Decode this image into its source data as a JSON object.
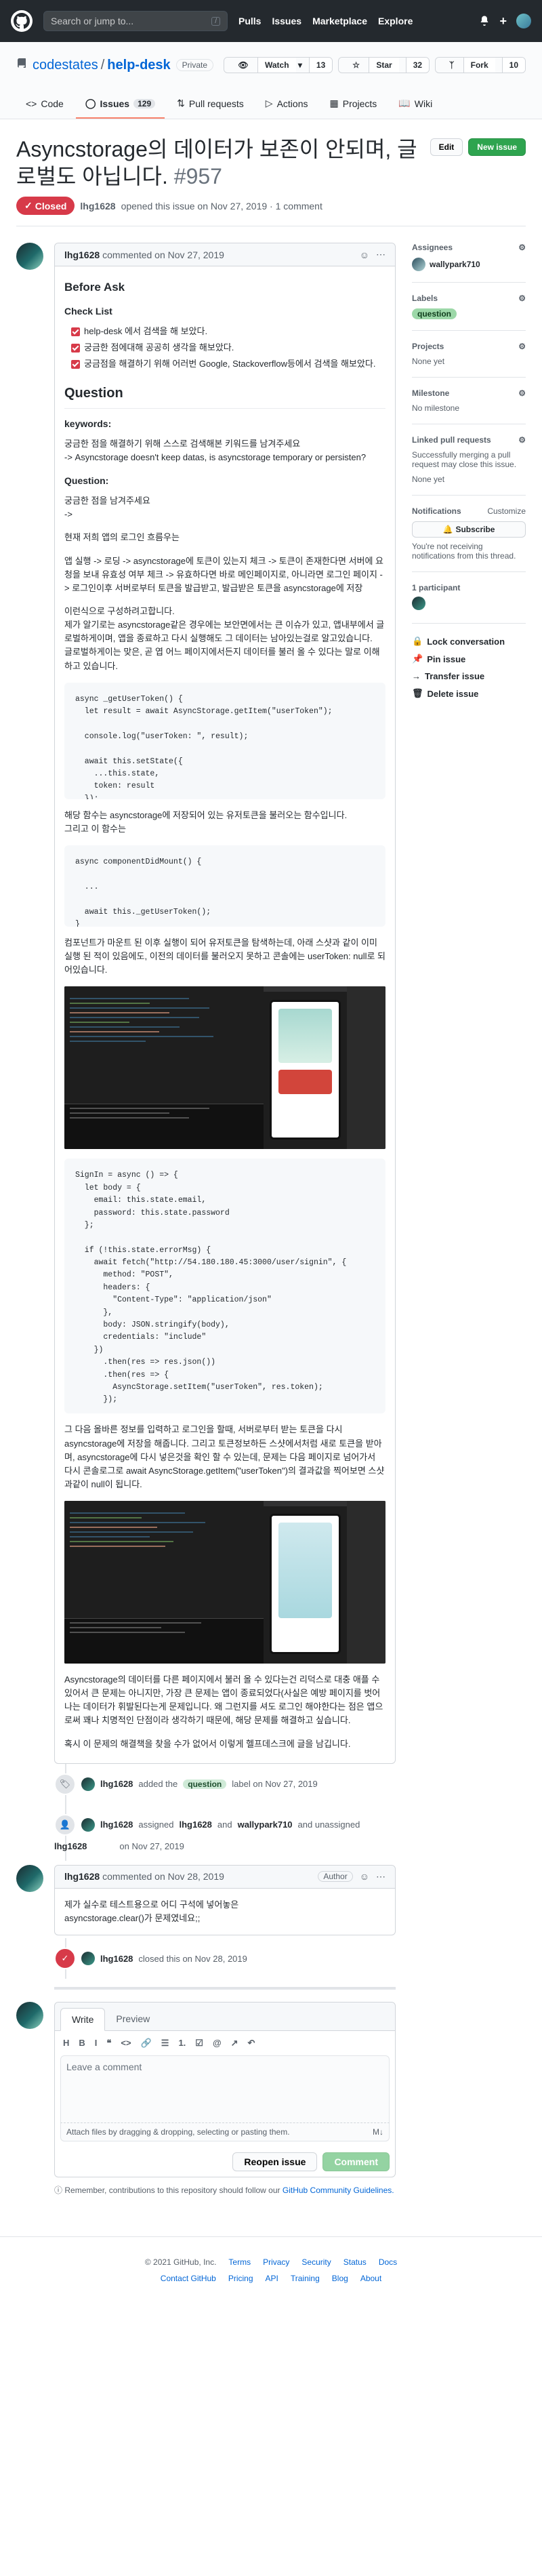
{
  "header": {
    "search_placeholder": "Search or jump to...",
    "search_key": "/",
    "nav": [
      "Pulls",
      "Issues",
      "Marketplace",
      "Explore"
    ],
    "plus": "+"
  },
  "repo": {
    "owner": "codestates",
    "name": "help-desk",
    "visibility": "Private",
    "watch_label": "Watch",
    "watch_count": "13",
    "star_label": "Star",
    "star_count": "32",
    "fork_label": "Fork",
    "fork_count": "10",
    "tabs": [
      {
        "label": "Code"
      },
      {
        "label": "Issues",
        "count": "129"
      },
      {
        "label": "Pull requests"
      },
      {
        "label": "Actions"
      },
      {
        "label": "Projects"
      },
      {
        "label": "Wiki"
      }
    ]
  },
  "issue": {
    "title": "Asyncstorage의 데이터가 보존이 안되며, 글로벌도 아닙니다.",
    "number": "#957",
    "edit_label": "Edit",
    "new_issue_label": "New issue",
    "state": "Closed",
    "author": "lhg1628",
    "opened_text": "opened this issue on Nov 27, 2019 · 1 comment"
  },
  "main_comment": {
    "author": "lhg1628",
    "date_text": "commented on Nov 27, 2019",
    "h_before": "Before Ask",
    "checklist_title": "Check List",
    "checklist": [
      "help-desk 에서 검색을 해 보았다.",
      "궁금한 점에대해 공공히 생각을 해보았다.",
      "궁금점을 해결하기 위해 어러번 Google, Stackoverflow등에서 검색을 해보았다."
    ],
    "h_question": "Question",
    "keywords_title": "keywords:",
    "keywords_text": "궁금한 점을 해결하기 위해 스스로 검색해본 키워드를 남겨주세요\n-> Asyncstorage doesn't keep datas, is asyncstorage temporary or persisten?",
    "question_title": "Question:",
    "question_text": "궁금한 점을 남겨주세요\n->",
    "p1": "현재 저희 앱의 로그인 흐름우는",
    "p2": "앱 실행 -> 로딩 -> asyncstorage에 토큰이 있는지 체크 -> 토큰이 존재한다면 서버에 요청을 보내 유효성 여부 체크 -> 유효하다면 바로 메인페이지로, 아니라면 로그인 페이지 -> 로그인이후 서버로부터 토큰을 발급받고, 발급받은 토큰을 asyncstorage에 저장",
    "p3": "이런식으로 구성하려고합니다.\n제가 알기로는 asyncstorage같은 경우에는 보안면에서는 큰 이슈가 있고, 앱내부에서 글로벌하게이며, 앱을 종료하고 다시 실행해도 그 데이터는 남아있는걸로 알고있습니다.\n글로벌하게이는 맞은, 곧 엽 어느 페이지에서든지 데이터를 불러 올 수 있다는 말로 이해 하고 있습니다.",
    "code1": "async _getUserToken() {\n  let result = await AsyncStorage.getItem(\"userToken\");\n\n  console.log(\"userToken: \", result);\n\n  await this.setState({\n    ...this.state,\n    token: result\n  });\n}",
    "p4": "해당 함수는 asyncstorage에 저장되어 있는 유저토큰을 불러오는 함수입니다.\n그리고 이 함수는",
    "code2": "async componentDidMount() {\n\n  ...\n\n  await this._getUserToken();\n}",
    "p5": "컴포넌트가 마운트 된 이후 실행이 되어 유저토큰을 탐색하는데, 아래 스샷과 같이 이미 실행 된 적이 있음에도, 이전의 데이터를 불러오지 못하고 콘솔에는 userToken: null로 되어있습니다.",
    "code3": "SignIn = async () => {\n  let body = {\n    email: this.state.email,\n    password: this.state.password\n  };\n\n  if (!this.state.errorMsg) {\n    await fetch(\"http://54.180.180.45:3000/user/signin\", {\n      method: \"POST\",\n      headers: {\n        \"Content-Type\": \"application/json\"\n      },\n      body: JSON.stringify(body),\n      credentials: \"include\"\n    })\n      .then(res => res.json())\n      .then(res => {\n        AsyncStorage.setItem(\"userToken\", res.token);\n      });\n\n    await this._getUserToken();\n\n    await this.props.navigation.navigate(\"MainPart\");\n  }\n};",
    "p6": "그 다음 올바른 정보를 입력하고 로그인을 할때, 서버로부터 받는 토큰을 다시 asyncstorage에 저장을 해줍니다. 그리고 토큰정보하든 스샷에서처럼 새로 토큰을 받아며, asyncstorage에 다시 넣은것을 확인 할 수 있는데, 문제는 다음 페이지로 넘어가서 다시 콘솔로그로 await AsyncStorage.getItem(\"userToken\")의 결과값을 찍어보면 스샷과같이 null이 됩니다.",
    "p7": "Asyncstorage의 데이터를 다른 페이지에서 불러 올 수 있다는건 리덕스로 대충 애플 수 있어서 큰 문제는 아니지만, 가장 큰 문제는 앱이 종료되었다(사실은 예방 페이지를 벗어나는 데이터가 휘발된다는게 문제입니다. 왜 그런지를 셔도 로그인 해야한다는 점은 앱으로써 꽤나 치명적인 단점이라 생각하기 때문에, 해당 문제를 해결하고 싶습니다.",
    "p8": "혹시 이 문제의 해결책을 찾을 수가 없어서 이렇게 헬프데스크에 글을 남깁니다."
  },
  "events": {
    "label_actor": "lhg1628",
    "label_text_a": "added the",
    "label_name": "question",
    "label_text_b": "label on Nov 27, 2019",
    "assign_actor": "lhg1628",
    "assign_text_a": "assigned",
    "assign_user_a": "lhg1628",
    "assign_and": "and",
    "assign_user_b": "wallypark710",
    "assign_text_b": "and unassigned",
    "assign_user_c": "lhg1628",
    "assign_date": "on Nov 27, 2019",
    "closed_actor": "lhg1628",
    "closed_text": "closed this on Nov 28, 2019"
  },
  "second_comment": {
    "author": "lhg1628",
    "date_text": "commented on Nov 28, 2019",
    "badge": "Author",
    "body": "제가 실수로 테스트용으로 어디 구석에 넣어놓은\nasyncstorage.clear()가 문제였네요;;"
  },
  "new_comment": {
    "tab_write": "Write",
    "tab_preview": "Preview",
    "tools": [
      "H",
      "B",
      "I",
      "❝",
      "<>",
      "🔗",
      "☰",
      "1.",
      "☑",
      "@",
      "↗",
      "↶"
    ],
    "placeholder": "Leave a comment",
    "attach_text": "Attach files by dragging & dropping, selecting or pasting them.",
    "md_badge": "M↓",
    "reopen_label": "Reopen issue",
    "comment_label": "Comment",
    "note_text": "Remember, contributions to this repository should follow our",
    "note_link": "GitHub Community Guidelines."
  },
  "sidebar": {
    "assignees_title": "Assignees",
    "assignee": "wallypark710",
    "labels_title": "Labels",
    "label": "question",
    "projects_title": "Projects",
    "projects_value": "None yet",
    "milestone_title": "Milestone",
    "milestone_value": "No milestone",
    "linked_title": "Linked pull requests",
    "linked_value": "Successfully merging a pull request may close this issue.",
    "linked_none": "None yet",
    "notifications_title": "Notifications",
    "customize": "Customize",
    "subscribe": "Subscribe",
    "notif_text": "You're not receiving notifications from this thread.",
    "participants": "1 participant",
    "lock": "Lock conversation",
    "pin": "Pin issue",
    "transfer": "Transfer issue",
    "delete": "Delete issue"
  },
  "footer": {
    "copyright": "© 2021 GitHub, Inc.",
    "links_a": [
      "Terms",
      "Privacy",
      "Security",
      "Status",
      "Docs"
    ],
    "links_b": [
      "Contact GitHub",
      "Pricing",
      "API",
      "Training",
      "Blog",
      "About"
    ]
  },
  "colors": {
    "closed": "#d73a49",
    "green": "#2ea44f",
    "accent_tab": "#f9826c",
    "link": "#0366d6"
  }
}
